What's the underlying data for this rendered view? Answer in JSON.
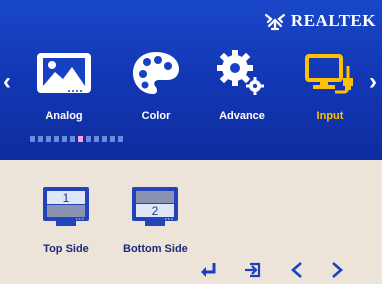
{
  "brand": {
    "name": "Realtek",
    "display": "REALTEK",
    "logo_icon": "realtek-crab-icon"
  },
  "menu": {
    "left_arrow": "‹",
    "right_arrow": "›",
    "tabs": [
      {
        "label": "Analog",
        "icon": "landscape-picture-icon",
        "selected": false
      },
      {
        "label": "Color",
        "icon": "palette-icon",
        "selected": false
      },
      {
        "label": "Advance",
        "icon": "gears-icon",
        "selected": false
      },
      {
        "label": "Input",
        "icon": "monitor-plug-icon",
        "selected": true
      }
    ],
    "page_indicator": {
      "count": 12,
      "active_index": 6
    }
  },
  "options": [
    {
      "label": "Top Side",
      "screen_number": "1",
      "icon": "monitor-top-icon"
    },
    {
      "label": "Bottom Side",
      "screen_number": "2",
      "icon": "monitor-bottom-icon"
    }
  ],
  "controls": [
    {
      "name": "enter",
      "icon": "enter-icon"
    },
    {
      "name": "exit",
      "icon": "exit-icon"
    },
    {
      "name": "previous",
      "icon": "chevron-left-icon"
    },
    {
      "name": "next",
      "icon": "chevron-right-icon"
    }
  ],
  "colors": {
    "header_blue": "#1640c0",
    "selected_tab": "#ffc000",
    "body_background": "#ece4d8",
    "control_blue": "#1a3fc4"
  }
}
